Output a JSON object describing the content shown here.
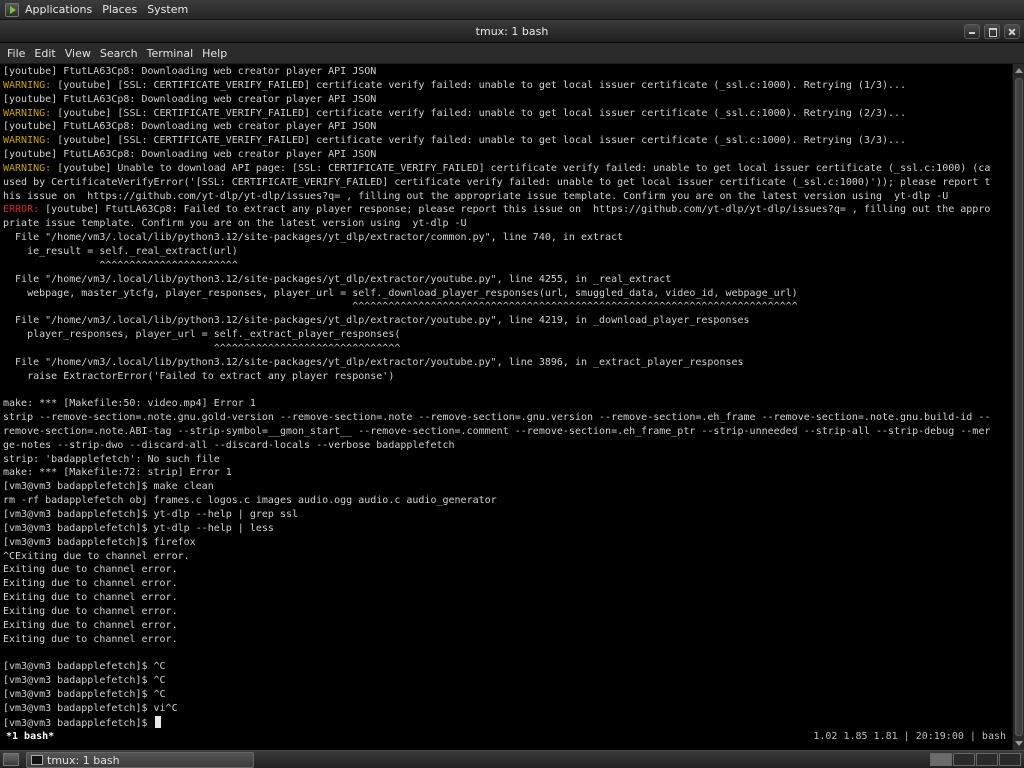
{
  "top_panel": {
    "logo_icon": "applications-launcher-icon",
    "menus": [
      "Applications",
      "Places",
      "System"
    ]
  },
  "window": {
    "title": "tmux: 1 bash"
  },
  "menubar": {
    "items": [
      "File",
      "Edit",
      "View",
      "Search",
      "Terminal",
      "Help"
    ]
  },
  "terminal": {
    "lines": [
      {
        "text": "[youtube] FtutLA63Cp8: Downloading web creator player API JSON"
      },
      {
        "prefix": "WARNING:",
        "prefix_kind": "warn",
        "text": " [youtube] [SSL: CERTIFICATE_VERIFY_FAILED] certificate verify failed: unable to get local issuer certificate (_ssl.c:1000). Retrying (1/3)..."
      },
      {
        "text": "[youtube] FtutLA63Cp8: Downloading web creator player API JSON"
      },
      {
        "prefix": "WARNING:",
        "prefix_kind": "warn",
        "text": " [youtube] [SSL: CERTIFICATE_VERIFY_FAILED] certificate verify failed: unable to get local issuer certificate (_ssl.c:1000). Retrying (2/3)..."
      },
      {
        "text": "[youtube] FtutLA63Cp8: Downloading web creator player API JSON"
      },
      {
        "prefix": "WARNING:",
        "prefix_kind": "warn",
        "text": " [youtube] [SSL: CERTIFICATE_VERIFY_FAILED] certificate verify failed: unable to get local issuer certificate (_ssl.c:1000). Retrying (3/3)..."
      },
      {
        "text": "[youtube] FtutLA63Cp8: Downloading web creator player API JSON"
      },
      {
        "prefix": "WARNING:",
        "prefix_kind": "warn",
        "text": " [youtube] Unable to download API page: [SSL: CERTIFICATE_VERIFY_FAILED] certificate verify failed: unable to get local issuer certificate (_ssl.c:1000) (ca"
      },
      {
        "text": "used by CertificateVerifyError('[SSL: CERTIFICATE_VERIFY_FAILED] certificate verify failed: unable to get local issuer certificate (_ssl.c:1000)')); please report t"
      },
      {
        "text": "his issue on  https://github.com/yt-dlp/yt-dlp/issues?q= , filling out the appropriate issue template. Confirm you are on the latest version using  yt-dlp -U"
      },
      {
        "prefix": "ERROR:",
        "prefix_kind": "err",
        "text": " [youtube] FtutLA63Cp8: Failed to extract any player response; please report this issue on  https://github.com/yt-dlp/yt-dlp/issues?q= , filling out the appro"
      },
      {
        "text": "priate issue template. Confirm you are on the latest version using  yt-dlp -U"
      },
      {
        "text": "  File \"/home/vm3/.local/lib/python3.12/site-packages/yt_dlp/extractor/common.py\", line 740, in extract"
      },
      {
        "text": "    ie_result = self._real_extract(url)"
      },
      {
        "text": "                ^^^^^^^^^^^^^^^^^^^^^^^"
      },
      {
        "text": "  File \"/home/vm3/.local/lib/python3.12/site-packages/yt_dlp/extractor/youtube.py\", line 4255, in _real_extract"
      },
      {
        "text": "    webpage, master_ytcfg, player_responses, player_url = self._download_player_responses(url, smuggled_data, video_id, webpage_url)"
      },
      {
        "text": "                                                          ^^^^^^^^^^^^^^^^^^^^^^^^^^^^^^^^^^^^^^^^^^^^^^^^^^^^^^^^^^^^^^^^^^^^^^^^^^"
      },
      {
        "text": "  File \"/home/vm3/.local/lib/python3.12/site-packages/yt_dlp/extractor/youtube.py\", line 4219, in _download_player_responses"
      },
      {
        "text": "    player_responses, player_url = self._extract_player_responses("
      },
      {
        "text": "                                   ^^^^^^^^^^^^^^^^^^^^^^^^^^^^^^^"
      },
      {
        "text": "  File \"/home/vm3/.local/lib/python3.12/site-packages/yt_dlp/extractor/youtube.py\", line 3896, in _extract_player_responses"
      },
      {
        "text": "    raise ExtractorError('Failed to extract any player response')"
      },
      {
        "text": ""
      },
      {
        "text": "make: *** [Makefile:50: video.mp4] Error 1"
      },
      {
        "text": "strip --remove-section=.note.gnu.gold-version --remove-section=.note --remove-section=.gnu.version --remove-section=.eh_frame --remove-section=.note.gnu.build-id --"
      },
      {
        "text": "remove-section=.note.ABI-tag --strip-symbol=__gmon_start__ --remove-section=.comment --remove-section=.eh_frame_ptr --strip-unneeded --strip-all --strip-debug --mer"
      },
      {
        "text": "ge-notes --strip-dwo --discard-all --discard-locals --verbose badapplefetch"
      },
      {
        "text": "strip: 'badapplefetch': No such file"
      },
      {
        "text": "make: *** [Makefile:72: strip] Error 1"
      },
      {
        "text": "[vm3@vm3 badapplefetch]$ make clean"
      },
      {
        "text": "rm -rf badapplefetch obj frames.c logos.c images audio.ogg audio.c audio_generator"
      },
      {
        "text": "[vm3@vm3 badapplefetch]$ yt-dlp --help | grep ssl"
      },
      {
        "text": "[vm3@vm3 badapplefetch]$ yt-dlp --help | less"
      },
      {
        "text": "[vm3@vm3 badapplefetch]$ firefox"
      },
      {
        "text": "^CExiting due to channel error."
      },
      {
        "text": "Exiting due to channel error."
      },
      {
        "text": "Exiting due to channel error."
      },
      {
        "text": "Exiting due to channel error."
      },
      {
        "text": "Exiting due to channel error."
      },
      {
        "text": "Exiting due to channel error."
      },
      {
        "text": "Exiting due to channel error."
      },
      {
        "text": ""
      },
      {
        "text": "[vm3@vm3 badapplefetch]$ ^C"
      },
      {
        "text": "[vm3@vm3 badapplefetch]$ ^C"
      },
      {
        "text": "[vm3@vm3 badapplefetch]$ ^C"
      },
      {
        "text": "[vm3@vm3 badapplefetch]$ vi^C"
      },
      {
        "text": "[vm3@vm3 badapplefetch]$ ",
        "cursor": true
      }
    ]
  },
  "tmux_status": {
    "left": " *1 bash*",
    "right": "1.02 1.85 1.81 | 20:19:00 | bash"
  },
  "taskbar": {
    "show_desktop_icon": "show-desktop-icon",
    "task_label": "tmux: 1 bash",
    "task_icon": "terminal-icon",
    "workspace_count": 4,
    "active_workspace": 1
  },
  "colors": {
    "warning_prefix": "#c8a000",
    "error_prefix": "#d22c2c",
    "terminal_fg": "#d0d0d0",
    "terminal_bg": "#000000"
  }
}
